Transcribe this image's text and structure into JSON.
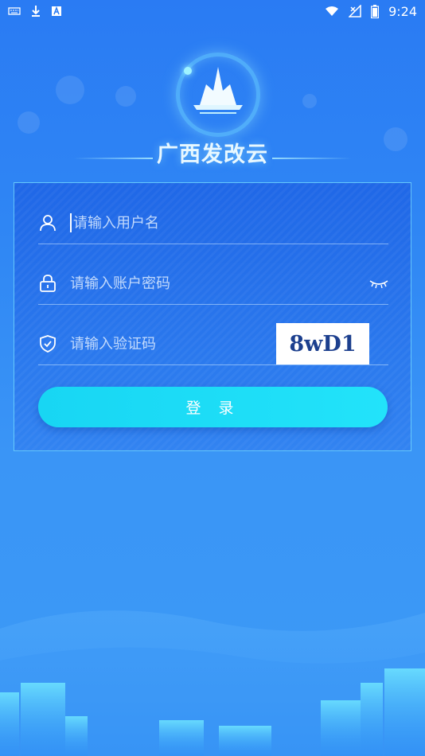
{
  "status_bar": {
    "time": "9:24",
    "left_icons": [
      "keyboard-icon",
      "download-icon",
      "a-box-icon"
    ],
    "right_icons": [
      "wifi-icon",
      "signal-icon",
      "battery-icon"
    ]
  },
  "app": {
    "title": "广西发改云",
    "logo": "stadium-logo-icon"
  },
  "login_form": {
    "username_placeholder": "请输入用户名",
    "password_placeholder": "请输入账户密码",
    "captcha_placeholder": "请输入验证码",
    "captcha_code": "8wD1",
    "login_label": "登 录"
  },
  "colors": {
    "background": "#2f86f4",
    "card_border": "#78e1ff",
    "button": "#18d6f3",
    "captcha_text": "#1c3f8e"
  }
}
